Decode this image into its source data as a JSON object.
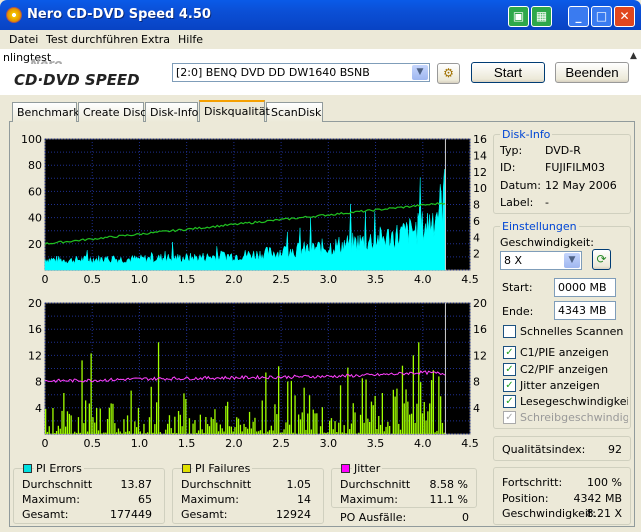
{
  "window": {
    "title": "Nero CD-DVD Speed 4.50"
  },
  "menu": [
    "Datei",
    "Test durchführen",
    "Extra",
    "Hilfe"
  ],
  "toolbar": {
    "fragment": "nlingtest",
    "logo": "CD·DVD SPEED",
    "logo_top": "Nero",
    "drive": "[2:0]  BENQ DVD DD DW1640 BSNB",
    "start": "Start",
    "stop": "Beenden"
  },
  "tabs": [
    "Benchmark",
    "Create Disc",
    "Disk-Info",
    "Diskqualität",
    "ScanDisk"
  ],
  "active_tab": "Diskqualität",
  "disk_info": {
    "title": "Disk-Info",
    "type_label": "Typ:",
    "type": "DVD-R",
    "id_label": "ID:",
    "id": "FUJIFILM03",
    "date_label": "Datum:",
    "date": "12 May 2006",
    "label_label": "Label:",
    "label": "-"
  },
  "settings": {
    "title": "Einstellungen",
    "speed_label": "Geschwindigkeit:",
    "speed": "8 X",
    "start_label": "Start:",
    "start": "0000 MB",
    "end_label": "Ende:",
    "end": "4343 MB",
    "quick_scan": "Schnelles Scannen",
    "c1": "C1/PIE anzeigen",
    "c2": "C2/PIF anzeigen",
    "jitter": "Jitter anzeigen",
    "read_speed": "Lesegeschwindigkeit a",
    "write_speed": "Schreibgeschwindigkei"
  },
  "quality": {
    "label": "Qualitätsindex:",
    "value": "92"
  },
  "progress": {
    "progress_label": "Fortschritt:",
    "progress": "100 %",
    "position_label": "Position:",
    "position": "4342 MB",
    "speed_label": "Geschwindigkeit:",
    "speed": "8.21 X"
  },
  "pi_errors": {
    "title": "PI Errors",
    "avg_label": "Durchschnitt",
    "avg": "13.87",
    "max_label": "Maximum:",
    "max": "65",
    "total_label": "Gesamt:",
    "total": "177449",
    "color": "#00e0e0"
  },
  "pi_failures": {
    "title": "PI Failures",
    "avg_label": "Durchschnitt",
    "avg": "1.05",
    "max_label": "Maximum:",
    "max": "14",
    "total_label": "Gesamt:",
    "total": "12924",
    "color": "#e0e000"
  },
  "jitter": {
    "title": "Jitter",
    "avg_label": "Durchschnitt",
    "avg": "8.58 %",
    "max_label": "Maximum:",
    "max": "11.1 %",
    "po_label": "PO Ausfälle:",
    "po": "0",
    "color": "#ff00ff"
  },
  "chart_data": [
    {
      "type": "area",
      "name": "pi-errors",
      "xlim": [
        0,
        4.5
      ],
      "ylim": [
        0,
        100
      ],
      "y2lim": [
        0,
        16
      ],
      "xticks": [
        "0",
        "0.5",
        "1.0",
        "1.5",
        "2.0",
        "2.5",
        "3.0",
        "3.5",
        "4.0",
        "4.5"
      ],
      "yticks": [
        "20",
        "40",
        "60",
        "80",
        "100"
      ],
      "y2ticks": [
        "2",
        "4",
        "6",
        "8",
        "10",
        "12",
        "14",
        "16"
      ],
      "pie": {
        "x": [
          0,
          0.25,
          0.5,
          0.75,
          1.0,
          1.25,
          1.5,
          1.75,
          2.0,
          2.25,
          2.5,
          2.75,
          3.0,
          3.25,
          3.5,
          3.75,
          4.0,
          4.1,
          4.2,
          4.24
        ],
        "y": [
          9,
          8,
          9,
          9,
          9,
          10,
          10,
          11,
          12,
          13,
          15,
          17,
          19,
          22,
          25,
          29,
          35,
          42,
          55,
          65
        ]
      },
      "read_speed": {
        "x": [
          0,
          4.24
        ],
        "y": [
          3.2,
          8.2
        ]
      },
      "color": "#00ffff"
    },
    {
      "type": "bar",
      "name": "pi-failures",
      "xlim": [
        0,
        4.5
      ],
      "ylim": [
        0,
        20
      ],
      "y2lim": [
        0,
        20
      ],
      "xticks": [
        "0",
        "0.5",
        "1.0",
        "1.5",
        "2.0",
        "2.5",
        "3.0",
        "3.5",
        "4.0",
        "4.5"
      ],
      "yticks": [
        "4",
        "8",
        "12",
        "16",
        "20"
      ],
      "y2ticks": [
        "4",
        "8",
        "12",
        "16",
        "20"
      ],
      "pif": {
        "x": [
          0,
          0.5,
          1.0,
          1.5,
          2.0,
          2.5,
          3.0,
          3.5,
          3.9,
          4.24
        ],
        "y": [
          3,
          3,
          4,
          3,
          3,
          3,
          3,
          3,
          8,
          4
        ]
      },
      "jitter": {
        "x": [
          0,
          0.5,
          1.0,
          1.5,
          2.0,
          2.5,
          3.0,
          3.5,
          4.0,
          4.24
        ],
        "y": [
          8.1,
          8.2,
          8.4,
          8.5,
          8.6,
          8.7,
          8.8,
          9.0,
          9.4,
          9.2
        ]
      },
      "color": "#a0ff00"
    }
  ]
}
